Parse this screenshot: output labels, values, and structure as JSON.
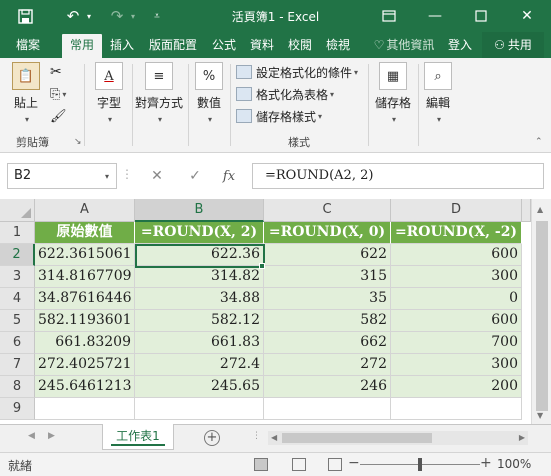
{
  "titlebar": {
    "title": "活頁簿1 - Excel",
    "bg": "#217346"
  },
  "tabs": [
    {
      "label": "檔案"
    },
    {
      "label": "常用",
      "active": true
    },
    {
      "label": "插入"
    },
    {
      "label": "版面配置"
    },
    {
      "label": "公式"
    },
    {
      "label": "資料"
    },
    {
      "label": "校閱"
    },
    {
      "label": "檢視"
    }
  ],
  "tellme": "其他資訊",
  "signin": "登入",
  "share": "共用",
  "ribbon": {
    "clipboard": {
      "paste": "貼上",
      "group": "剪貼簿"
    },
    "font": "字型",
    "alignment": "對齊方式",
    "number": "數值",
    "styles": {
      "conditional": "設定格式化的條件",
      "table": "格式化為表格",
      "cell_styles": "儲存格樣式",
      "group": "樣式"
    },
    "cells": "儲存格",
    "editing": "編輯"
  },
  "formula_bar": {
    "name_box": "B2",
    "formula": "=ROUND(A2, 2)",
    "fx_icon": "fx"
  },
  "grid": {
    "columns": [
      "A",
      "B",
      "C",
      "D"
    ],
    "selected_column": "B",
    "selected_row": "2",
    "rows": [
      "1",
      "2",
      "3",
      "4",
      "5",
      "6",
      "7",
      "8",
      "9"
    ],
    "header_row": [
      "原始數值",
      "=ROUND(X, 2)",
      "=ROUND(X, 0)",
      "=ROUND(X, -2)"
    ],
    "data": [
      [
        "622.3615061",
        "622.36",
        "622",
        "600"
      ],
      [
        "314.8167709",
        "314.82",
        "315",
        "300"
      ],
      [
        "34.87616446",
        "34.88",
        "35",
        "0"
      ],
      [
        "582.1193601",
        "582.12",
        "582",
        "600"
      ],
      [
        "661.83209",
        "661.83",
        "662",
        "700"
      ],
      [
        "272.4025721",
        "272.4",
        "272",
        "300"
      ],
      [
        "245.6461213",
        "245.65",
        "246",
        "200"
      ]
    ],
    "header_color": "#70ad47",
    "data_color": "#e2efda"
  },
  "sheet_tab": "工作表1",
  "status": {
    "text": "就緒",
    "zoom": "100%"
  }
}
